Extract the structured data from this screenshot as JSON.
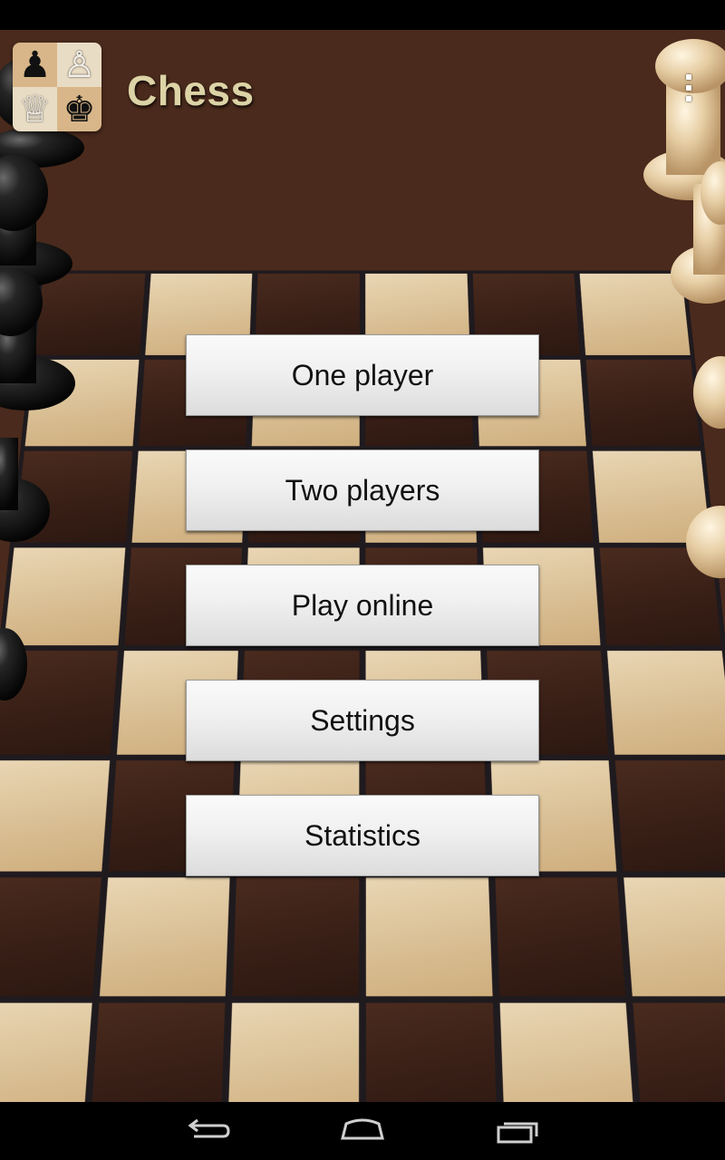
{
  "app_bar": {
    "title": "Chess",
    "icon_name": "chess-app-icon",
    "title_color": "#dcd3a6",
    "overflow_icon": "overflow-menu-icon"
  },
  "menu": {
    "buttons": [
      {
        "label": "One player"
      },
      {
        "label": "Two players"
      },
      {
        "label": "Play online"
      },
      {
        "label": "Settings"
      },
      {
        "label": "Statistics"
      }
    ]
  },
  "nav_bar": {
    "back_icon": "back-icon",
    "home_icon": "home-icon",
    "recents_icon": "recent-apps-icon"
  },
  "colors": {
    "board_light": "#e0c9a0",
    "board_dark": "#3a2017",
    "button_bg": "#f0f0f0",
    "button_text": "#111111"
  }
}
